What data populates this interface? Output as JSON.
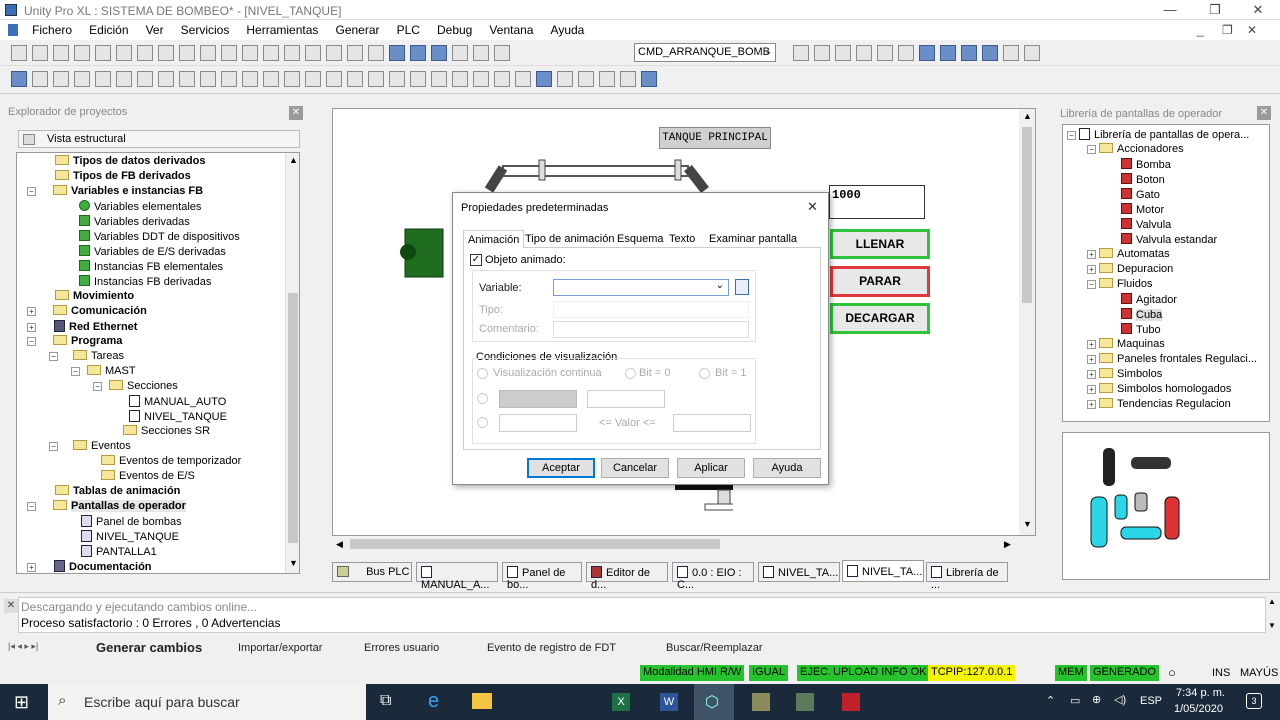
{
  "window": {
    "title": "Unity Pro XL : SISTEMA DE BOMBEO* - [NIVEL_TANQUE]"
  },
  "menu": [
    "Fichero",
    "Edición",
    "Ver",
    "Servicios",
    "Herramientas",
    "Generar",
    "PLC",
    "Debug",
    "Ventana",
    "Ayuda"
  ],
  "toolbar": {
    "combo_value": "CMD_ARRANQUE_BOMB"
  },
  "explorer": {
    "header": "Explorador de proyectos",
    "view_label": "Vista estructural",
    "items": [
      "Tipos de datos derivados",
      "Tipos de FB derivados",
      "Variables e instancias FB",
      "Variables elementales",
      "Variables derivadas",
      "Variables DDT de dispositivos",
      "Variables de E/S derivadas",
      "Instancias FB elementales",
      "Instancias FB derivadas",
      "Movimiento",
      "Comunicación",
      "Red Ethernet",
      "Programa",
      "Tareas",
      "MAST",
      "Secciones",
      "MANUAL_AUTO",
      "NIVEL_TANQUE",
      "Secciones SR",
      "Eventos",
      "Eventos de temporizador",
      "Eventos de E/S",
      "Tablas de animación",
      "Pantallas de operador",
      "Panel de bombas",
      "NIVEL_TANQUE",
      "PANTALLA1",
      "Documentación"
    ]
  },
  "screen": {
    "tank_title": "TANQUE PRINCIPAL",
    "level_value": "1000",
    "btn_llenar": "LLENAR",
    "btn_parar": "PARAR",
    "btn_decargar": "DECARGAR"
  },
  "dialog": {
    "title": "Propiedades predeterminadas",
    "tabs": [
      "Animación",
      "Tipo de animación",
      "Esquema",
      "Texto",
      "Examinar pantalla"
    ],
    "animated_object": "Objeto animado:",
    "variable_label": "Variable:",
    "tipo_label": "Tipo:",
    "comentario_label": "Comentario:",
    "conditions_title": "Condiciones de visualización",
    "continuous": "Visualización continua",
    "bit0": "Bit = 0",
    "bit1": "Bit = 1",
    "valor_label": "<= Valor <=",
    "buttons": [
      "Aceptar",
      "Cancelar",
      "Aplicar",
      "Ayuda"
    ]
  },
  "library": {
    "header": "Librería de pantallas de operador",
    "items": [
      "Librería de pantallas de opera...",
      "Accionadores",
      "Bomba",
      "Boton",
      "Gato",
      "Motor",
      "Valvula",
      "Valvula estandar",
      "Automatas",
      "Depuracion",
      "Fluidos",
      "Agitador",
      "Cuba",
      "Tubo",
      "Maquinas",
      "Paneles frontales Regulaci...",
      "Simbolos",
      "Simbolos homologados",
      "Tendencias Regulacion"
    ]
  },
  "doc_tabs": [
    "Bus PLC",
    "MANUAL_A...",
    "Panel de bo...",
    "Editor de d...",
    "0.0 : EIO : C...",
    "NIVEL_TA...",
    "NIVEL_TA...",
    "Librería de ..."
  ],
  "output": {
    "line1": "Descargando y ejecutando cambios online...",
    "line2": "Proceso satisfactorio  : 0 Errores , 0 Advertencias",
    "tabs": [
      "Generar cambios",
      "Importar/exportar",
      "Errores usuario",
      "Evento de registro de FDT",
      "Buscar/Reemplazar"
    ]
  },
  "status": {
    "items": [
      "Modalidad HMI R/W",
      "IGUAL",
      "EJEC.",
      "UPLOAD INFO OK",
      "TCPIP:127.0.0.1",
      "MEM",
      "GENERADO"
    ],
    "ins": "INS",
    "caps": "MAYÚS"
  },
  "taskbar": {
    "search": "Escribe aquí para buscar",
    "lang": "ESP",
    "time": "7:34 p. m.",
    "date": "1/05/2020",
    "notif": "3"
  },
  "colors": {
    "accent_green": "#2ec43a",
    "accent_red": "#e0383c",
    "status_yellow": "#f4f400"
  }
}
